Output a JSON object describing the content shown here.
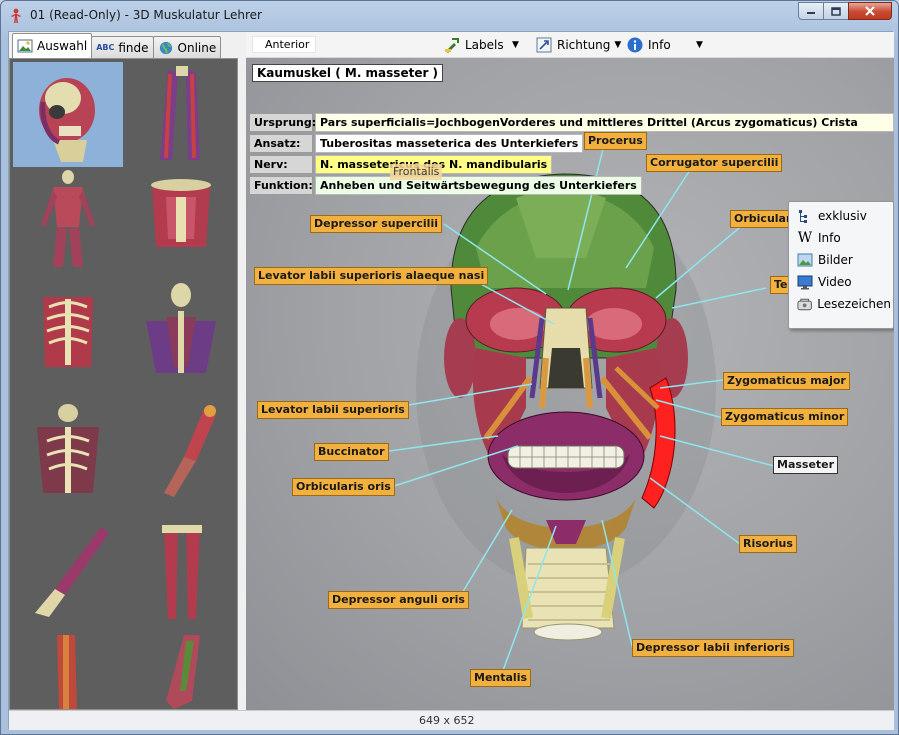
{
  "window": {
    "title": "01 (Read-Only) - 3D Muskulatur Lehrer"
  },
  "left_tabs": [
    {
      "label": "Auswahl"
    },
    {
      "label": "finde",
      "icon_text": "ABC"
    },
    {
      "label": "Online"
    }
  ],
  "thumbnails": [
    "head-skull",
    "arm-muscles",
    "full-body-back",
    "torso-front",
    "ribcage",
    "upper-torso-back",
    "chest-front",
    "arm-side",
    "forearm-hand",
    "legs-back",
    "lower-leg",
    "foot"
  ],
  "toolbar": {
    "view": "Anterior",
    "labels": "Labels",
    "richtung": "Richtung",
    "info": "Info"
  },
  "muscle_info": {
    "title": "Kaumuskel ( M. masseter )",
    "rows": [
      {
        "key": "Ursprung:",
        "value": "Pars superficialis=JochbogenVorderes und mittleres Drittel (Arcus zygomaticus) Crista facialis"
      },
      {
        "key": "Ansatz:",
        "value": "Tuberositas masseterica des Unterkiefers"
      },
      {
        "key": "Nerv:",
        "value": "N. massetericus des N. mandibularis"
      },
      {
        "key": "Funktion:",
        "value": "Anheben und Seitwärtsbewegung des Unterkiefers"
      }
    ]
  },
  "labels": {
    "procerus": "Procerus",
    "corrugator": "Corrugator supercilii",
    "orbicularis_oculi": "Orbiculari",
    "temporalis": "Te",
    "frontalis": "Frontalis",
    "depressor_supercilii": "Depressor supercilii",
    "levator_alaeque": "Levator labii superioris alaeque nasi",
    "levator_sup": "Levator labii superioris",
    "buccinator": "Buccinator",
    "orbicularis_oris": "Orbicularis oris",
    "zyg_major": "Zygomaticus major",
    "zyg_minor": "Zygomaticus minor",
    "masseter": "Masseter",
    "risorius": "Risorius",
    "depressor_anguli": "Depressor anguli oris",
    "depressor_labii": "Depressor labii inferioris",
    "mentalis": "Mentalis"
  },
  "context_menu": [
    {
      "label": "exklusiv",
      "icon": "tree-icon"
    },
    {
      "label": "Info",
      "icon": "wikipedia-icon"
    },
    {
      "label": "Bilder",
      "icon": "picture-icon"
    },
    {
      "label": "Video",
      "icon": "monitor-icon"
    },
    {
      "label": "Lesezeichen",
      "icon": "bookmark-icon"
    }
  ],
  "status": {
    "size": "649 x 652"
  },
  "colors": {
    "label_bg": "#f2b13e",
    "leader_line": "#8ee6ee",
    "muscle_red": "#c03a4e",
    "muscle_purple": "#8c2d6a",
    "bone": "#e8e2b4",
    "masseter_highlight": "#ff2020"
  }
}
